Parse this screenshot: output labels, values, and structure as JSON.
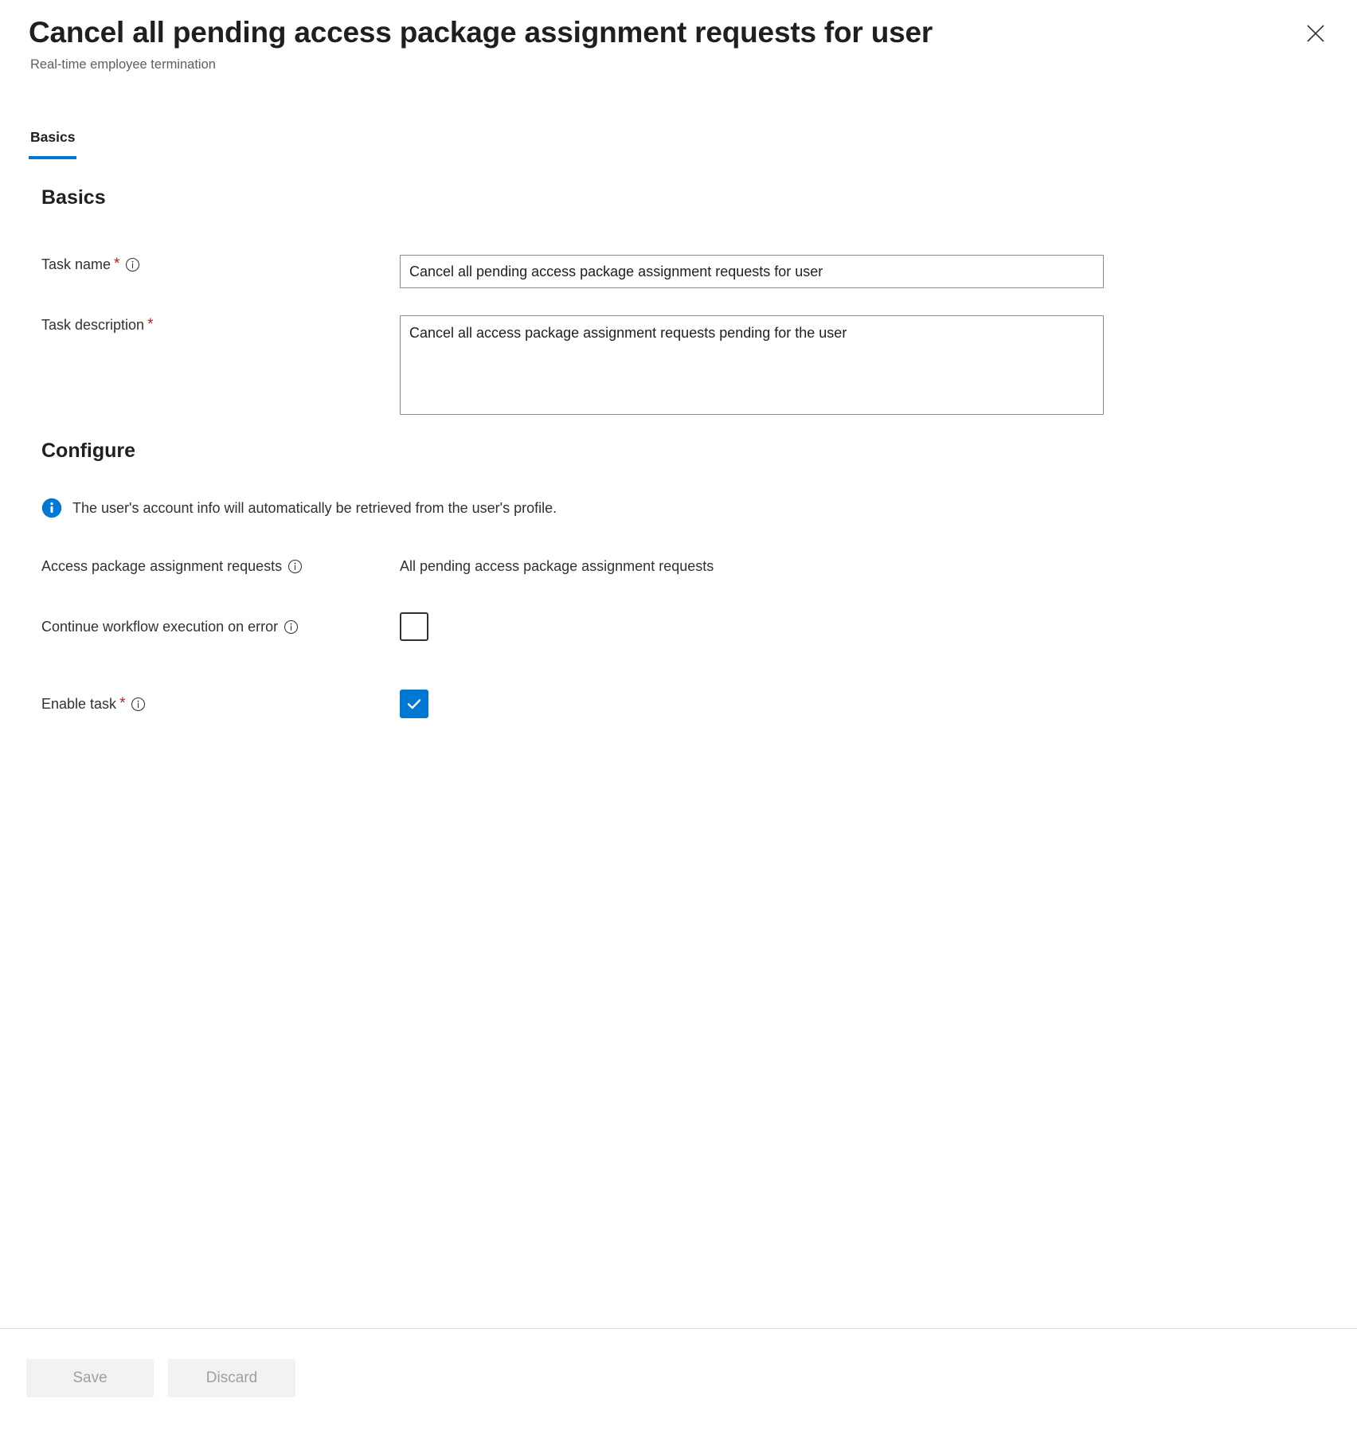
{
  "header": {
    "title": "Cancel all pending access package assignment requests for user",
    "subtitle": "Real-time employee termination",
    "close_label": "Close"
  },
  "tabs": [
    {
      "label": "Basics",
      "active": true
    }
  ],
  "sections": {
    "basics_heading": "Basics",
    "configure_heading": "Configure"
  },
  "fields": {
    "task_name": {
      "label": "Task name",
      "required_marker": "*",
      "value": "Cancel all pending access package assignment requests for user",
      "placeholder": "Task name"
    },
    "task_description": {
      "label": "Task description",
      "required_marker": "*",
      "value": "Cancel all access package assignment requests pending for the user",
      "placeholder": "Task description"
    },
    "access_package_requests": {
      "label": "Access package assignment requests",
      "value": "All pending access package assignment requests"
    },
    "continue_on_error": {
      "label": "Continue workflow execution on error",
      "checked": false
    },
    "enable_task": {
      "label": "Enable task",
      "required_marker": "*",
      "checked": true
    }
  },
  "info_banner": {
    "message": "The user's account info will automatically be retrieved from the user's profile."
  },
  "footer": {
    "save_label": "Save",
    "discard_label": "Discard"
  },
  "colors": {
    "accent": "#0078d4",
    "required": "#a4262c",
    "border": "#8a8886",
    "disabled_bg": "#f3f2f1",
    "disabled_text": "#a19f9d",
    "subtitle": "#605e5c"
  }
}
